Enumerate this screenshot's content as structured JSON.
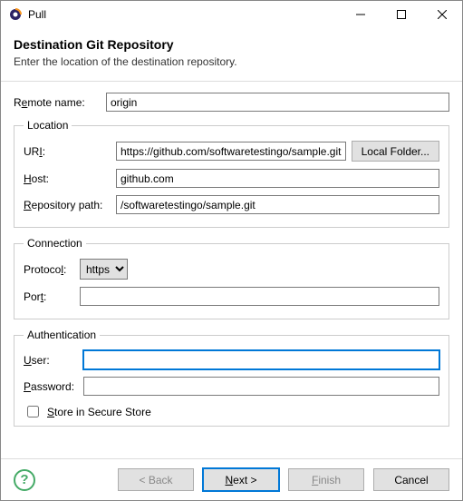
{
  "titlebar": {
    "title": "Pull"
  },
  "header": {
    "title": "Destination Git Repository",
    "subtitle": "Enter the location of the destination repository."
  },
  "remote": {
    "label_pre": "R",
    "label_u": "e",
    "label_post": "mote name:",
    "value": "origin"
  },
  "location": {
    "legend": "Location",
    "uri": {
      "label_pre": "UR",
      "label_u": "I",
      "label_post": ":",
      "value": "https://github.com/softwaretestingo/sample.git"
    },
    "local_folder": "Local Folder...",
    "host": {
      "label_u": "H",
      "label_post": "ost:",
      "value": "github.com"
    },
    "repo": {
      "label_u": "R",
      "label_post": "epository path:",
      "value": "/softwaretestingo/sample.git"
    }
  },
  "connection": {
    "legend": "Connection",
    "protocol": {
      "label_pre": "Protoco",
      "label_u": "l",
      "label_post": ":",
      "value": "https"
    },
    "port": {
      "label_pre": "Por",
      "label_u": "t",
      "label_post": ":",
      "value": ""
    }
  },
  "authentication": {
    "legend": "Authentication",
    "user": {
      "label_u": "U",
      "label_post": "ser:",
      "value": ""
    },
    "password": {
      "label_u": "P",
      "label_post": "assword:",
      "value": ""
    },
    "store": {
      "label_u": "S",
      "label_post": "tore in Secure Store",
      "checked": false
    }
  },
  "footer": {
    "back": "< Back",
    "next_u": "N",
    "next_post": "ext >",
    "finish_u": "F",
    "finish_post": "inish",
    "cancel": "Cancel"
  }
}
